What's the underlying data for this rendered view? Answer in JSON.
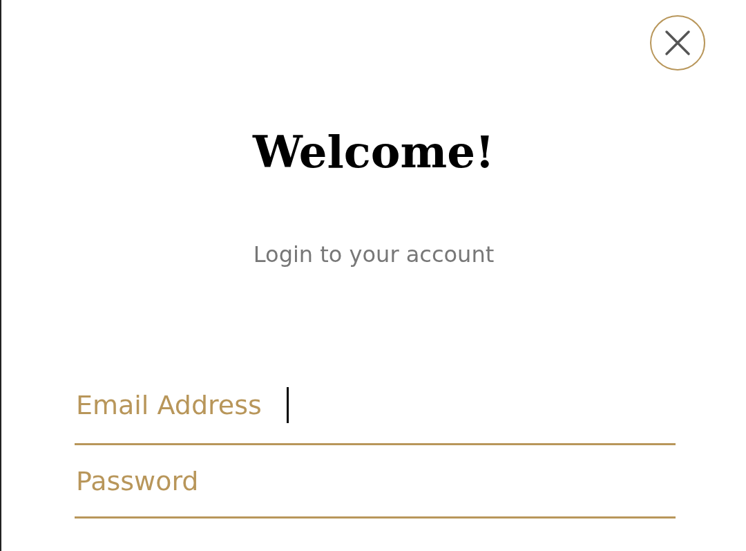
{
  "dialog": {
    "title": "Welcome!",
    "subtitle": "Login to your account"
  },
  "fields": [
    {
      "label": "Email Address",
      "focused": true
    },
    {
      "label": "Password",
      "focused": false
    }
  ]
}
